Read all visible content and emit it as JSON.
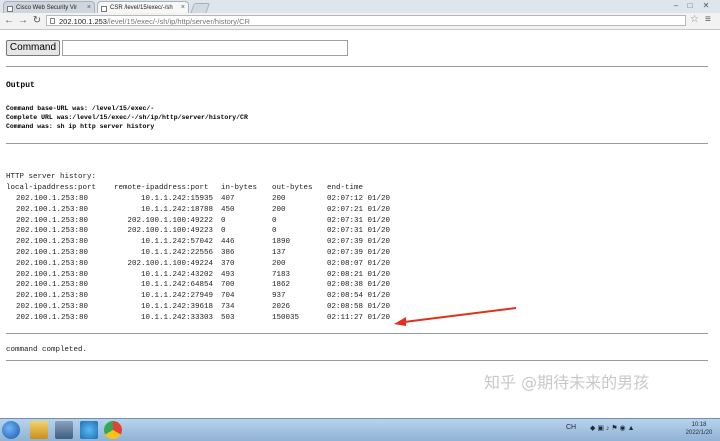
{
  "browser": {
    "tabs": [
      {
        "title": "Cisco Web Security Vir",
        "active": false
      },
      {
        "title": "CSR /level/15/exec/-/sh",
        "active": true
      }
    ],
    "url_host": "202.100.1.253",
    "url_path": "/level/15/exec/-/sh/ip/http/server/history/CR"
  },
  "form": {
    "command_button": "Command",
    "command_input_value": ""
  },
  "output": {
    "heading": "Output",
    "base_url_line": "Command base-URL was: /level/15/exec/-",
    "complete_url_line": "Complete URL was:/level/15/exec/-/sh/ip/http/server/history/CR",
    "command_line": "Command was: sh  ip http server history"
  },
  "history": {
    "title": "HTTP server history:",
    "headers": {
      "local": "local-ipaddress:port",
      "remote": "remote-ipaddress:port",
      "in": "in-bytes",
      "out": "out-bytes",
      "end": "end-time"
    },
    "rows": [
      {
        "local": "202.100.1.253:80",
        "remote": "10.1.1.242:15935",
        "in": "407",
        "out": "200",
        "end": "02:07:12 01/20"
      },
      {
        "local": "202.100.1.253:80",
        "remote": "10.1.1.242:18788",
        "in": "450",
        "out": "200",
        "end": "02:07:21 01/20"
      },
      {
        "local": "202.100.1.253:80",
        "remote": "202.100.1.100:49222",
        "in": "0",
        "out": "0",
        "end": "02:07:31 01/20"
      },
      {
        "local": "202.100.1.253:80",
        "remote": "202.100.1.100:49223",
        "in": "0",
        "out": "0",
        "end": "02:07:31 01/20"
      },
      {
        "local": "202.100.1.253:80",
        "remote": "10.1.1.242:57042",
        "in": "446",
        "out": "1890",
        "end": "02:07:39 01/20"
      },
      {
        "local": "202.100.1.253:80",
        "remote": "10.1.1.242:22556",
        "in": "386",
        "out": "137",
        "end": "02:07:39 01/20"
      },
      {
        "local": "202.100.1.253:80",
        "remote": "202.100.1.100:49224",
        "in": "370",
        "out": "200",
        "end": "02:08:07 01/20"
      },
      {
        "local": "202.100.1.253:80",
        "remote": "10.1.1.242:43202",
        "in": "493",
        "out": "7183",
        "end": "02:08:21 01/20"
      },
      {
        "local": "202.100.1.253:80",
        "remote": "10.1.1.242:64854",
        "in": "700",
        "out": "1862",
        "end": "02:08:38 01/20"
      },
      {
        "local": "202.100.1.253:80",
        "remote": "10.1.1.242:27949",
        "in": "704",
        "out": "937",
        "end": "02:08:54 01/20"
      },
      {
        "local": "202.100.1.253:80",
        "remote": "10.1.1.242:39618",
        "in": "734",
        "out": "2026",
        "end": "02:08:58 01/20"
      },
      {
        "local": "202.100.1.253:80",
        "remote": "10.1.1.242:33303",
        "in": "503",
        "out": "150035",
        "end": "02:11:27 01/20"
      }
    ],
    "completed": "command completed."
  },
  "annotation": {
    "arrow_color": "#e0301e"
  },
  "watermark": "知乎 @期待未来的男孩",
  "taskbar": {
    "tray_lang": "CH",
    "time": "10:18",
    "date": "2022/1/20"
  }
}
